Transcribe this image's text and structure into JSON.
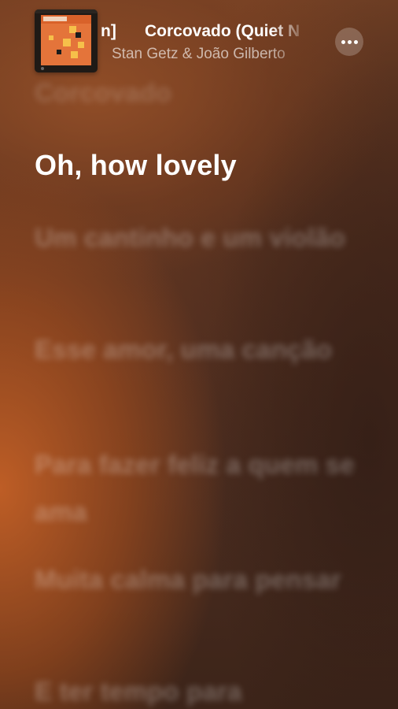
{
  "now_playing": {
    "title_prefix": "n]",
    "title": "Corcovado (Quiet N",
    "artist": "Stan Getz & João Gilberto",
    "more_icon": "more-icon"
  },
  "lyrics": {
    "previous": "Corcovado",
    "current": "Oh, how lovely",
    "upcoming": [
      "Um cantinho e um violão",
      "Esse amor, uma canção",
      "Para fazer feliz a quem se ama",
      "Muita calma para pensar",
      "E ter tempo para"
    ]
  },
  "colors": {
    "accent_orange": "#c4602a",
    "text_primary": "#ffffff"
  }
}
